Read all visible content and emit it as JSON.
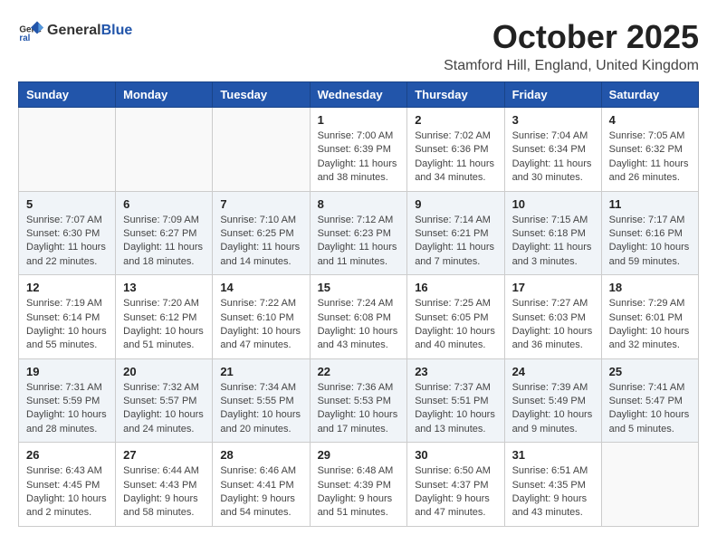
{
  "header": {
    "logo_general": "General",
    "logo_blue": "Blue",
    "month": "October 2025",
    "location": "Stamford Hill, England, United Kingdom"
  },
  "days_of_week": [
    "Sunday",
    "Monday",
    "Tuesday",
    "Wednesday",
    "Thursday",
    "Friday",
    "Saturday"
  ],
  "weeks": [
    [
      {
        "day": "",
        "info": ""
      },
      {
        "day": "",
        "info": ""
      },
      {
        "day": "",
        "info": ""
      },
      {
        "day": "1",
        "info": "Sunrise: 7:00 AM\nSunset: 6:39 PM\nDaylight: 11 hours\nand 38 minutes."
      },
      {
        "day": "2",
        "info": "Sunrise: 7:02 AM\nSunset: 6:36 PM\nDaylight: 11 hours\nand 34 minutes."
      },
      {
        "day": "3",
        "info": "Sunrise: 7:04 AM\nSunset: 6:34 PM\nDaylight: 11 hours\nand 30 minutes."
      },
      {
        "day": "4",
        "info": "Sunrise: 7:05 AM\nSunset: 6:32 PM\nDaylight: 11 hours\nand 26 minutes."
      }
    ],
    [
      {
        "day": "5",
        "info": "Sunrise: 7:07 AM\nSunset: 6:30 PM\nDaylight: 11 hours\nand 22 minutes."
      },
      {
        "day": "6",
        "info": "Sunrise: 7:09 AM\nSunset: 6:27 PM\nDaylight: 11 hours\nand 18 minutes."
      },
      {
        "day": "7",
        "info": "Sunrise: 7:10 AM\nSunset: 6:25 PM\nDaylight: 11 hours\nand 14 minutes."
      },
      {
        "day": "8",
        "info": "Sunrise: 7:12 AM\nSunset: 6:23 PM\nDaylight: 11 hours\nand 11 minutes."
      },
      {
        "day": "9",
        "info": "Sunrise: 7:14 AM\nSunset: 6:21 PM\nDaylight: 11 hours\nand 7 minutes."
      },
      {
        "day": "10",
        "info": "Sunrise: 7:15 AM\nSunset: 6:18 PM\nDaylight: 11 hours\nand 3 minutes."
      },
      {
        "day": "11",
        "info": "Sunrise: 7:17 AM\nSunset: 6:16 PM\nDaylight: 10 hours\nand 59 minutes."
      }
    ],
    [
      {
        "day": "12",
        "info": "Sunrise: 7:19 AM\nSunset: 6:14 PM\nDaylight: 10 hours\nand 55 minutes."
      },
      {
        "day": "13",
        "info": "Sunrise: 7:20 AM\nSunset: 6:12 PM\nDaylight: 10 hours\nand 51 minutes."
      },
      {
        "day": "14",
        "info": "Sunrise: 7:22 AM\nSunset: 6:10 PM\nDaylight: 10 hours\nand 47 minutes."
      },
      {
        "day": "15",
        "info": "Sunrise: 7:24 AM\nSunset: 6:08 PM\nDaylight: 10 hours\nand 43 minutes."
      },
      {
        "day": "16",
        "info": "Sunrise: 7:25 AM\nSunset: 6:05 PM\nDaylight: 10 hours\nand 40 minutes."
      },
      {
        "day": "17",
        "info": "Sunrise: 7:27 AM\nSunset: 6:03 PM\nDaylight: 10 hours\nand 36 minutes."
      },
      {
        "day": "18",
        "info": "Sunrise: 7:29 AM\nSunset: 6:01 PM\nDaylight: 10 hours\nand 32 minutes."
      }
    ],
    [
      {
        "day": "19",
        "info": "Sunrise: 7:31 AM\nSunset: 5:59 PM\nDaylight: 10 hours\nand 28 minutes."
      },
      {
        "day": "20",
        "info": "Sunrise: 7:32 AM\nSunset: 5:57 PM\nDaylight: 10 hours\nand 24 minutes."
      },
      {
        "day": "21",
        "info": "Sunrise: 7:34 AM\nSunset: 5:55 PM\nDaylight: 10 hours\nand 20 minutes."
      },
      {
        "day": "22",
        "info": "Sunrise: 7:36 AM\nSunset: 5:53 PM\nDaylight: 10 hours\nand 17 minutes."
      },
      {
        "day": "23",
        "info": "Sunrise: 7:37 AM\nSunset: 5:51 PM\nDaylight: 10 hours\nand 13 minutes."
      },
      {
        "day": "24",
        "info": "Sunrise: 7:39 AM\nSunset: 5:49 PM\nDaylight: 10 hours\nand 9 minutes."
      },
      {
        "day": "25",
        "info": "Sunrise: 7:41 AM\nSunset: 5:47 PM\nDaylight: 10 hours\nand 5 minutes."
      }
    ],
    [
      {
        "day": "26",
        "info": "Sunrise: 6:43 AM\nSunset: 4:45 PM\nDaylight: 10 hours\nand 2 minutes."
      },
      {
        "day": "27",
        "info": "Sunrise: 6:44 AM\nSunset: 4:43 PM\nDaylight: 9 hours\nand 58 minutes."
      },
      {
        "day": "28",
        "info": "Sunrise: 6:46 AM\nSunset: 4:41 PM\nDaylight: 9 hours\nand 54 minutes."
      },
      {
        "day": "29",
        "info": "Sunrise: 6:48 AM\nSunset: 4:39 PM\nDaylight: 9 hours\nand 51 minutes."
      },
      {
        "day": "30",
        "info": "Sunrise: 6:50 AM\nSunset: 4:37 PM\nDaylight: 9 hours\nand 47 minutes."
      },
      {
        "day": "31",
        "info": "Sunrise: 6:51 AM\nSunset: 4:35 PM\nDaylight: 9 hours\nand 43 minutes."
      },
      {
        "day": "",
        "info": ""
      }
    ]
  ]
}
